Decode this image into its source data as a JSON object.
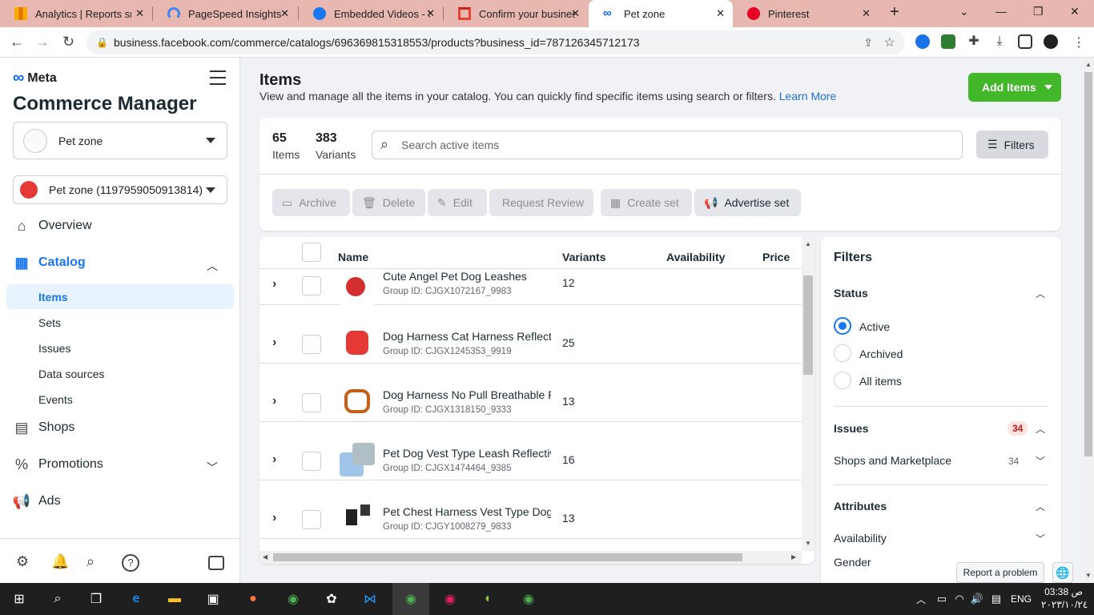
{
  "browser": {
    "tabs": [
      {
        "title": "Analytics | Reports sn",
        "icon": "analytics-icon"
      },
      {
        "title": "PageSpeed Insights",
        "icon": "pagespeed-icon"
      },
      {
        "title": "Embedded Videos - S",
        "icon": "facebook-icon"
      },
      {
        "title": "Confirm your busines",
        "icon": "gmail-icon"
      },
      {
        "title": "Pet zone",
        "icon": "meta-icon"
      },
      {
        "title": "Pinterest",
        "icon": "pinterest-icon"
      }
    ],
    "url": "business.facebook.com/commerce/catalogs/696369815318553/products?business_id=787126345712173"
  },
  "sidebar": {
    "brand": "Meta",
    "title": "Commerce Manager",
    "catalog_selector": "Pet zone",
    "page_selector": "Pet zone (1197959050913814)",
    "nav": [
      {
        "label": "Overview",
        "icon": "home-icon"
      },
      {
        "label": "Catalog",
        "icon": "grid-icon"
      },
      {
        "label": "Shops",
        "icon": "shop-icon"
      },
      {
        "label": "Promotions",
        "icon": "percent-icon"
      },
      {
        "label": "Ads",
        "icon": "megaphone-icon"
      }
    ],
    "catalog_sub": [
      "Items",
      "Sets",
      "Issues",
      "Data sources",
      "Events"
    ]
  },
  "page": {
    "title": "Items",
    "description": "View and manage all the items in your catalog. You can quickly find specific items using search or filters.",
    "learn_more": "Learn More",
    "add_items": "Add Items",
    "items_count": "65",
    "items_label": "Items",
    "variants_count": "383",
    "variants_label": "Variants",
    "search_placeholder": "Search active items",
    "filters_button": "Filters",
    "actions": {
      "archive": "Archive",
      "delete": "Delete",
      "edit": "Edit",
      "request_review": "Request Review",
      "create_set": "Create set",
      "advertise_set": "Advertise set"
    },
    "columns": {
      "name": "Name",
      "variants": "Variants",
      "availability": "Availability",
      "price": "Price"
    },
    "rows": [
      {
        "name": "Cute Angel Pet Dog Leashes",
        "group": "Group ID: CJGX1072167_9983",
        "variants": "12"
      },
      {
        "name": "Dog Harness Cat Harness Reflect",
        "group": "Group ID: CJGX1245353_9919",
        "variants": "25"
      },
      {
        "name": "Dog Harness No Pull Breathable F",
        "group": "Group ID: CJGX1318150_9333",
        "variants": "13"
      },
      {
        "name": "Pet Dog Vest Type Leash Reflectiv",
        "group": "Group ID: CJGX1474464_9385",
        "variants": "16"
      },
      {
        "name": "Pet Chest Harness Vest Type Dog",
        "group": "Group ID: CJGY1008279_9833",
        "variants": "13"
      }
    ]
  },
  "filters": {
    "title": "Filters",
    "status": "Status",
    "status_options": [
      "Active",
      "Archived",
      "All items"
    ],
    "issues": "Issues",
    "issues_count": "34",
    "shops_marketplace": "Shops and Marketplace",
    "shops_count": "34",
    "attributes": "Attributes",
    "availability": "Availability",
    "gender": "Gender"
  },
  "report_problem": "Report a problem",
  "taskbar": {
    "lang": "ENG",
    "time": "03:38 ص",
    "date": "٢٠٢٣/١٠/٢٤"
  }
}
